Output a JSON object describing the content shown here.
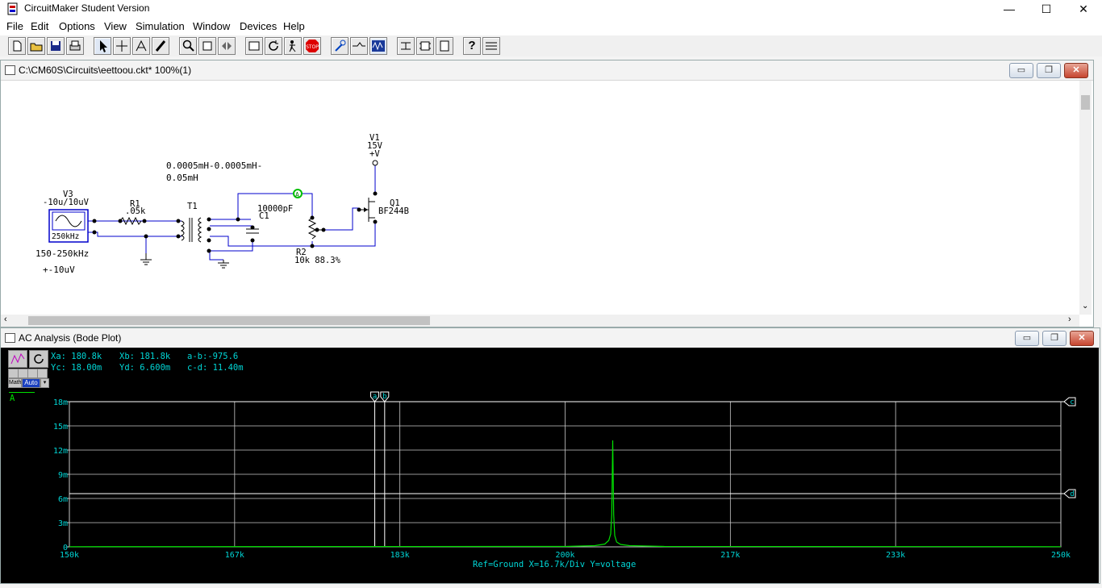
{
  "app": {
    "title": "CircuitMaker Student Version",
    "window_controls": [
      "—",
      "☐",
      "✕"
    ]
  },
  "menu": [
    "File",
    "Edit",
    "Options",
    "View",
    "Simulation",
    "Window",
    "Devices",
    "Help"
  ],
  "toolbar": {
    "icons": [
      "new-icon",
      "open-icon",
      "save-icon",
      "print-icon",
      "arrow-icon",
      "wire-icon",
      "text-icon",
      "probe-icon",
      "zoom-icon",
      "rotate-icon",
      "mirror-icon",
      "digital-icon",
      "reset-icon",
      "step-icon",
      "stop-icon",
      "probe-tool-icon",
      "trace-icon",
      "analysis-icon",
      "switch-icon",
      "macro-icon",
      "device-icon",
      "help-icon",
      "info-icon"
    ],
    "stop_label": "STOP",
    "help_label": "?"
  },
  "schematic_window": {
    "title": "C:\\CM60S\\Circuits\\eettoou.ckt* 100%(1)",
    "buttons": [
      "▭",
      "❐",
      "✕"
    ],
    "labels": {
      "v3_name": "V3",
      "v3_value": "-10u/10uV",
      "v3_freq": "250kHz",
      "sweep": "150-250kHz",
      "amp": "+-10uV",
      "r1_name": "R1",
      "r1_value": ".05k",
      "t1_name": "T1",
      "t1_value_line1": "0.0005mH-0.0005mH-",
      "t1_value_line2": "0.05mH",
      "c1_name": "C1",
      "c1_value": "10000pF",
      "r2_name": "R2",
      "r2_value": "10k 88.3%",
      "v1_name": "V1",
      "v1_value": "15V",
      "v1_node": "+V",
      "q1_name": "Q1",
      "q1_part": "BF244B",
      "probe": "A"
    }
  },
  "bode_window": {
    "title": "AC Analysis (Bode Plot)",
    "buttons": [
      "▭",
      "❐",
      "✕"
    ],
    "readout": {
      "xa": "Xa: 180.8k",
      "xb": "Xb: 181.8k",
      "ab": "a-b:-975.6",
      "yc": "Yc: 18.00m",
      "yd": "Yd: 6.600m",
      "cd": "c-d: 11.40m"
    },
    "tools": {
      "math": "Math",
      "auto": "Auto"
    },
    "trace_label": "A",
    "footer": "Ref=Ground  X=16.7k/Div Y=voltage",
    "cursor_labels": [
      "a",
      "b",
      "c",
      "d"
    ],
    "colors": {
      "trace": "#00e000",
      "text": "#00d6d6",
      "grid": "#c8c8c8"
    }
  },
  "chart_data": {
    "type": "line",
    "xlim": [
      150,
      250
    ],
    "ylim": [
      0,
      18
    ],
    "x_tick_labels": [
      "150k",
      "167k",
      "183k",
      "200k",
      "217k",
      "233k",
      "250k"
    ],
    "y_tick_labels": [
      "0",
      "3m",
      "6m",
      "9m",
      "12m",
      "15m",
      "18m"
    ],
    "series": [
      {
        "name": "A",
        "x": [
          150,
          200,
          203,
          204,
          204.4,
          204.6,
          204.7,
          204.8,
          204.9,
          205,
          205.2,
          205.6,
          206.5,
          210,
          250
        ],
        "y": [
          0.02,
          0.05,
          0.15,
          0.35,
          0.8,
          1.6,
          4.0,
          13.2,
          4.0,
          1.4,
          0.6,
          0.3,
          0.15,
          0.05,
          0.02
        ]
      }
    ],
    "cursors": {
      "a": 180.8,
      "b": 181.8,
      "c": 18.0,
      "d": 6.6
    },
    "grid": true
  }
}
